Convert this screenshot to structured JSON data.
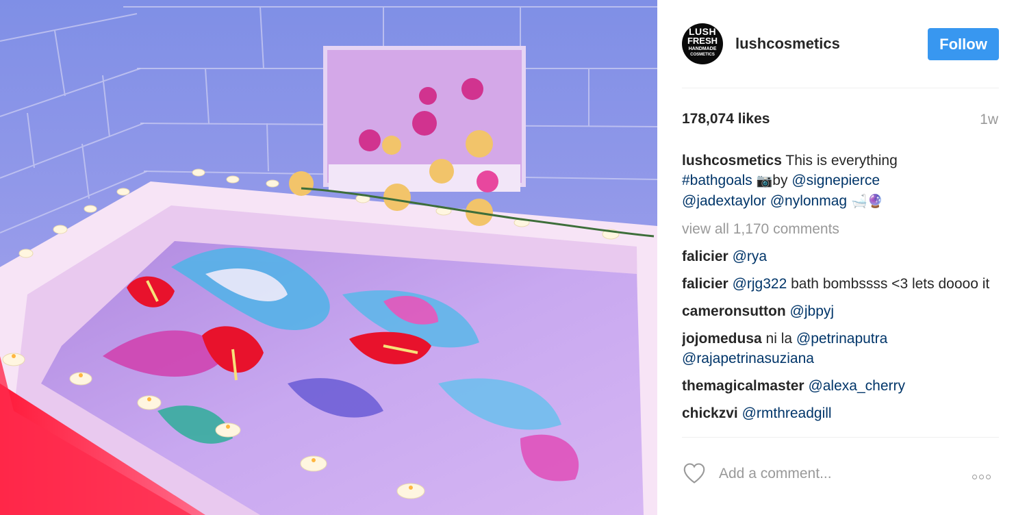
{
  "post": {
    "image_alt": "Bathtub with swirling pink and blue bath bomb water surrounded by tea light candles and flowers"
  },
  "header": {
    "avatar_lines": [
      "LUSH",
      "FRESH",
      "HANDMADE",
      "COSMETICS"
    ],
    "username": "lushcosmetics",
    "follow_label": "Follow"
  },
  "stats": {
    "likes": "178,074 likes",
    "time_ago": "1w"
  },
  "caption": {
    "author": "lushcosmetics",
    "text": "This is everything",
    "hashtag": "#bathgoals",
    "camera_emoji": "📷",
    "by": "by",
    "mention1": "@signepierce",
    "mention2": "@jadextaylor",
    "mention3": "@nylonmag",
    "emojis_end": "🛁🔮"
  },
  "view_all": "view all 1,170 comments",
  "comments": [
    {
      "author": "falicier",
      "mention": "@rya",
      "text": ""
    },
    {
      "author": "falicier",
      "mention": "@rjg322",
      "text": "bath bombssss <3 lets doooo it"
    },
    {
      "author": "cameronsutton",
      "mention": "@jbpyj",
      "text": ""
    },
    {
      "author": "jojomedusa",
      "text_before": "ni la",
      "mention": "@petrinaputra",
      "mention2": "@rajapetrinasuziana"
    },
    {
      "author": "themagicalmaster",
      "mention": "@alexa_cherry",
      "text": ""
    },
    {
      "author": "chickzvi",
      "mention": "@rmthreadgill",
      "text": ""
    }
  ],
  "add_comment": {
    "placeholder": "Add a comment..."
  },
  "colors": {
    "follow_bg": "#3897f0",
    "mention": "#003569",
    "muted": "#999999"
  },
  "icons": [
    "heart-icon",
    "more-options-icon"
  ]
}
